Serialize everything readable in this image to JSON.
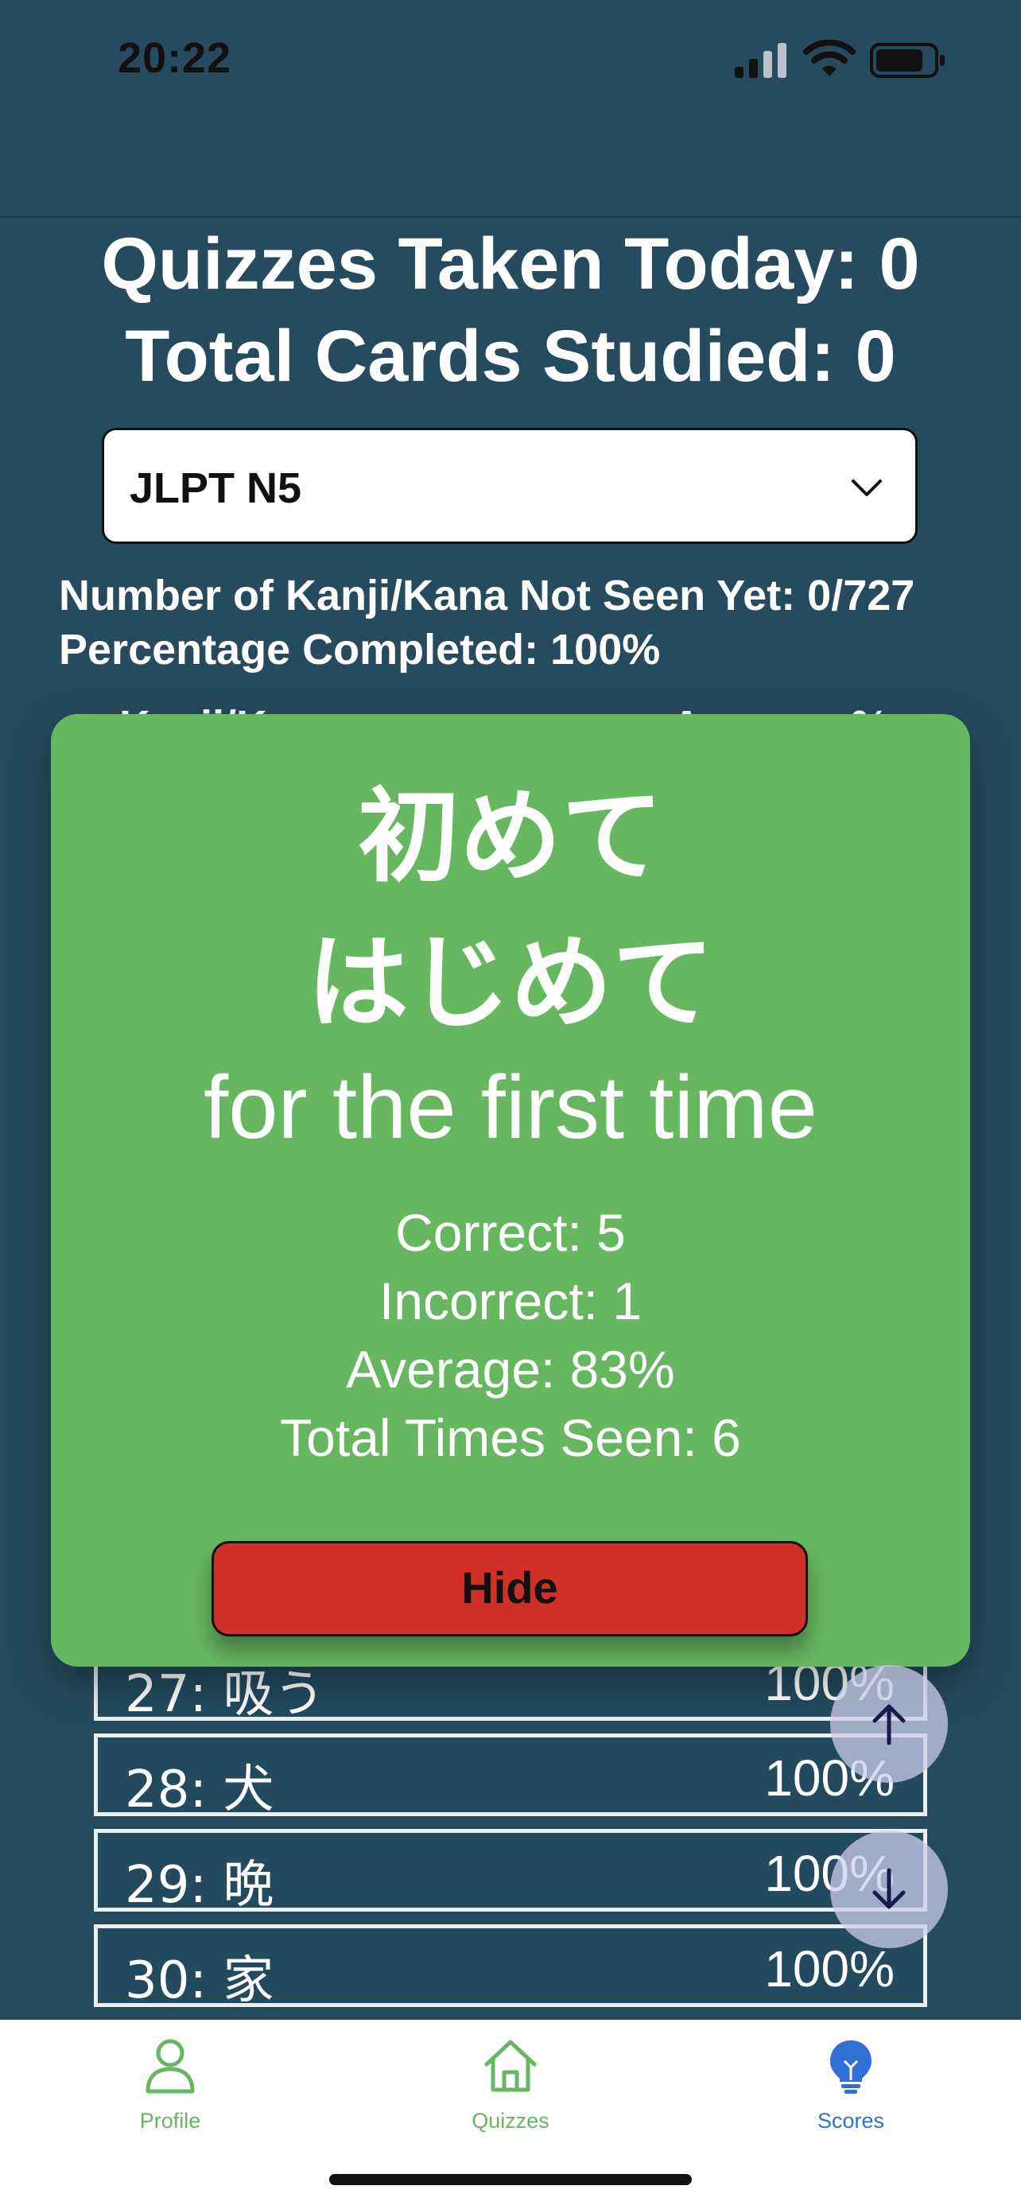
{
  "status_bar": {
    "time": "20:22"
  },
  "stats": {
    "quizzes_taken_today": "Quizzes Taken Today: 0",
    "total_cards_studied": "Total Cards Studied: 0"
  },
  "level_select": {
    "value": "JLPT N5"
  },
  "progress": {
    "not_seen": "Number of Kanji/Kana Not Seen Yet: 0/727",
    "percentage": "Percentage Completed: 100%"
  },
  "table": {
    "header_kanji": "Kanji/Kana",
    "header_average": "Average %",
    "rows": [
      {
        "label": "27: 吸う",
        "value": "100%"
      },
      {
        "label": "28: 犬",
        "value": "100%"
      },
      {
        "label": "29: 晩",
        "value": "100%"
      },
      {
        "label": "30: 家",
        "value": "100%"
      }
    ]
  },
  "modal": {
    "kanji": "初めて",
    "kana": "はじめて",
    "meaning": "for the first time",
    "correct": "Correct: 5",
    "incorrect": "Incorrect: 1",
    "average": "Average: 83%",
    "total_seen": "Total Times Seen: 6",
    "hide_label": "Hide"
  },
  "tabs": [
    {
      "label": "Profile",
      "icon": "person-icon",
      "color": "#67b761"
    },
    {
      "label": "Quizzes",
      "icon": "home-icon",
      "color": "#67b761"
    },
    {
      "label": "Scores",
      "icon": "lightbulb-icon",
      "color": "#2f6fd6"
    }
  ],
  "colors": {
    "background": "#264a5e",
    "modal": "#67b761",
    "hide_button": "#cf3128",
    "active_tab": "#2f6fd6"
  }
}
